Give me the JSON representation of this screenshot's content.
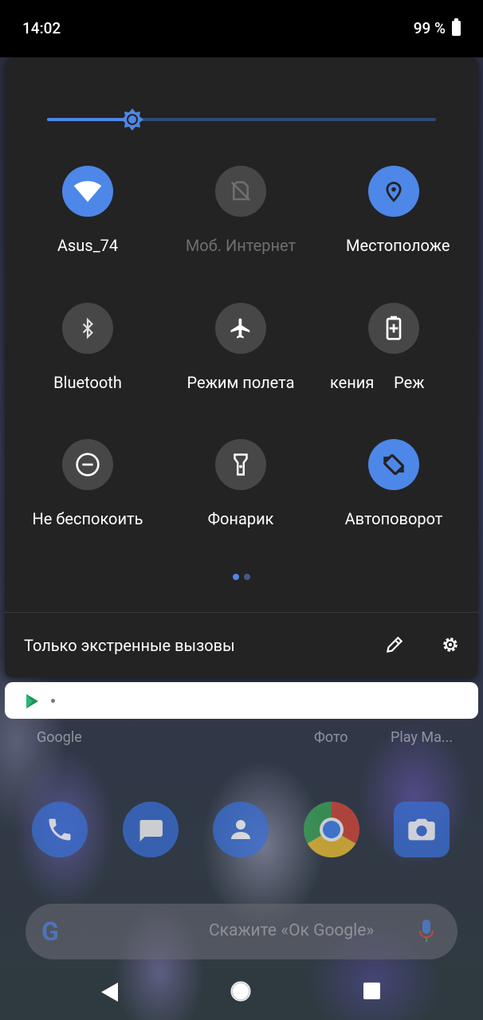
{
  "status_bar": {
    "time": "14:02",
    "battery": "99 %"
  },
  "quick_settings": {
    "brightness": {
      "level": 0.22
    },
    "tiles": [
      {
        "id": "wifi",
        "label": "Asus_74",
        "icon": "wifi-icon",
        "state": "on"
      },
      {
        "id": "mobile-data",
        "label": "Моб. Интернет",
        "icon": "no-sim-icon",
        "state": "disabled"
      },
      {
        "id": "location",
        "label": "Местоположе",
        "icon": "location-pin-icon",
        "state": "on"
      },
      {
        "id": "bluetooth",
        "label": "Bluetooth",
        "icon": "bluetooth-icon",
        "state": "off"
      },
      {
        "id": "airplane",
        "label": "Режим полета",
        "icon": "airplane-icon",
        "state": "off"
      },
      {
        "id": "battery-saver",
        "label": "кения     Реж",
        "icon": "battery-saver-icon",
        "state": "off"
      },
      {
        "id": "dnd",
        "label": "Не беспокоить",
        "icon": "do-not-disturb-icon",
        "state": "off"
      },
      {
        "id": "flashlight",
        "label": "Фонарик",
        "icon": "flashlight-icon",
        "state": "off"
      },
      {
        "id": "autorotate",
        "label": "Автоповорот",
        "icon": "autorotate-icon",
        "state": "on"
      }
    ],
    "page_indicator": {
      "pages": 2,
      "current": 1
    },
    "footer": {
      "status_text": "Только экстренные вызовы"
    }
  },
  "home": {
    "app_labels": [
      "Google",
      "Фото",
      "Play Ma..."
    ],
    "search_placeholder": "Скажите «Ок Google»"
  },
  "colors": {
    "accent": "#4d87e8",
    "panel": "#232323",
    "tile_off": "#474747"
  }
}
